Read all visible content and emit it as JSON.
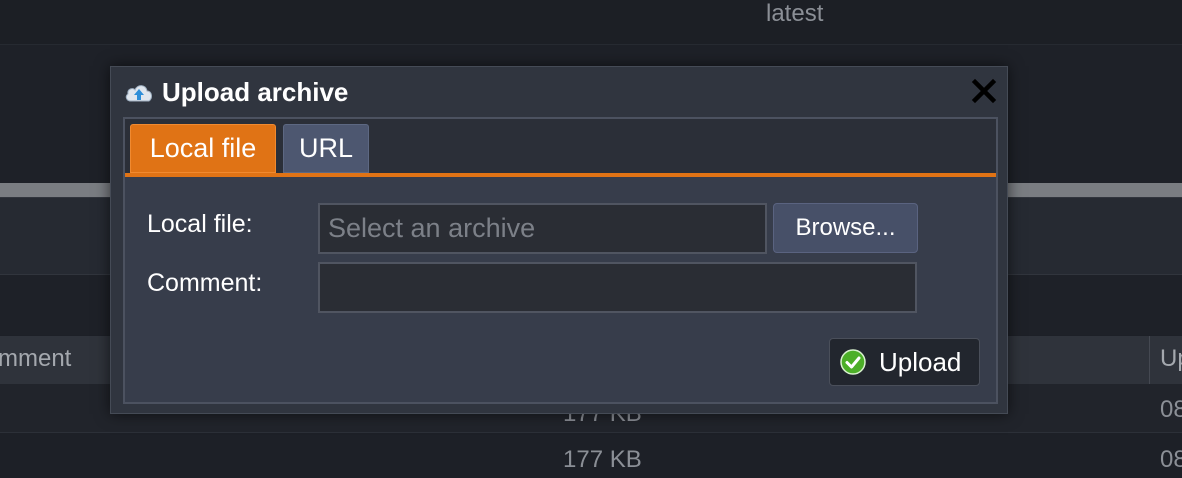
{
  "background": {
    "latest_label": "latest",
    "table": {
      "comment_header": "mment",
      "uploaded_header": "Up",
      "rows": [
        {
          "size": "177 KB",
          "date": "08"
        },
        {
          "size": "177 KB",
          "date": "08"
        }
      ]
    }
  },
  "dialog": {
    "title": "Upload archive",
    "tabs": [
      {
        "label": "Local file",
        "active": true
      },
      {
        "label": "URL",
        "active": false
      }
    ],
    "form": {
      "local_file_label": "Local file:",
      "local_file_placeholder": "Select an archive",
      "local_file_value": "",
      "browse_label": "Browse...",
      "comment_label": "Comment:",
      "comment_value": ""
    },
    "upload_label": "Upload"
  },
  "colors": {
    "accent": "#e07315",
    "dialog_bg": "#30353f",
    "success": "#4caf28"
  },
  "icons": {
    "title": "cloud-upload-icon",
    "close": "close-icon",
    "upload": "check-circle-icon"
  }
}
